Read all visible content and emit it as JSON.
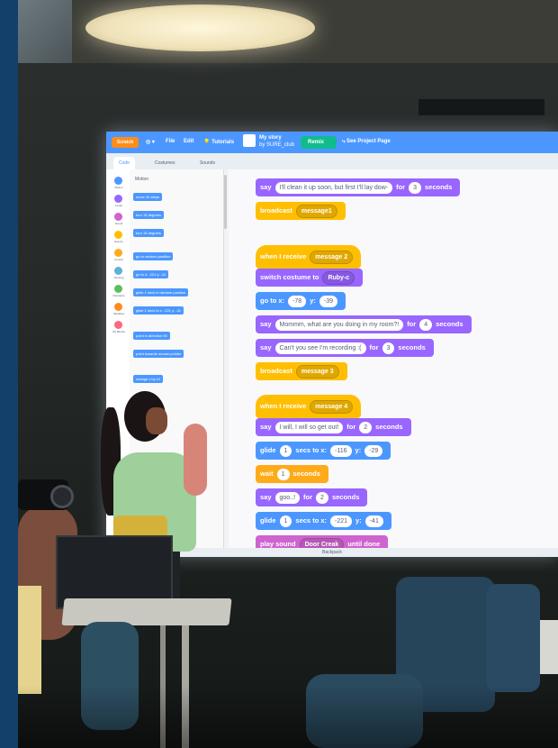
{
  "scratch": {
    "menu": [
      "File",
      "Edit",
      "Tutorials"
    ],
    "project_title": "My story",
    "author": "by SURE_club",
    "remix_label": "Remix",
    "see_project": "See Project Page",
    "tabs": [
      "Code",
      "Costumes",
      "Sounds"
    ],
    "categories": [
      "Motion",
      "Looks",
      "Sound",
      "Events",
      "Control",
      "Sensing",
      "Operators",
      "Variables",
      "My Blocks"
    ],
    "category_colors": [
      "#4c97ff",
      "#9966ff",
      "#cf63cf",
      "#ffbf00",
      "#ffab19",
      "#5cb1d6",
      "#59c059",
      "#ff8c1a",
      "#ff6680"
    ],
    "palette_title": "Motion",
    "palette_blocks": [
      "move 10 steps",
      "turn 15 degrees",
      "turn 15 degrees",
      "go to random position",
      "go to x: -221 y: -41",
      "glide 1 secs to random position",
      "glide 1 secs to x: -221 y: -41",
      "point in direction 90",
      "point towards mouse-pointer",
      "change x by 10"
    ],
    "backpack": "Backpack",
    "script_blocks": [
      {
        "kind": "looks",
        "words": [
          "say"
        ],
        "pill": "I'll clean it up soon, but first I'll lay dow-",
        "mid": "for",
        "pill2": "3",
        "end": "seconds"
      },
      {
        "kind": "event",
        "words": [
          "broadcast"
        ],
        "dd": "message1"
      },
      {
        "kind": "event hat",
        "words": [
          "when I receive"
        ],
        "dd": "message 2"
      },
      {
        "kind": "looks",
        "words": [
          "switch costume to"
        ],
        "dd": "Ruby-c"
      },
      {
        "kind": "motion",
        "words": [
          "go to x:"
        ],
        "pill": "-78",
        "mid": "y:",
        "pill2": "-39"
      },
      {
        "kind": "looks",
        "words": [
          "say"
        ],
        "pill": "Mommm, what are you doing in my room?!",
        "mid": "for",
        "pill2": "4",
        "end": "seconds"
      },
      {
        "kind": "looks",
        "words": [
          "say"
        ],
        "pill": "Can't you see I'm recording :(",
        "mid": "for",
        "pill2": "3",
        "end": "seconds"
      },
      {
        "kind": "event",
        "words": [
          "broadcast"
        ],
        "dd": "message 3"
      },
      {
        "kind": "event hat",
        "words": [
          "when I receive"
        ],
        "dd": "message 4"
      },
      {
        "kind": "looks",
        "words": [
          "say"
        ],
        "pill": "I will, I will so get out!",
        "mid": "for",
        "pill2": "2",
        "end": "seconds"
      },
      {
        "kind": "motion",
        "words": [
          "glide"
        ],
        "pill": "1",
        "mid": "secs to x:",
        "pill2": "-116",
        "mid2": "y:",
        "pill3": "-29"
      },
      {
        "kind": "control",
        "words": [
          "wait"
        ],
        "pill": "1",
        "end": "seconds"
      },
      {
        "kind": "looks",
        "words": [
          "say"
        ],
        "pill": "goo..!",
        "mid": "for",
        "pill2": "2",
        "end": "seconds"
      },
      {
        "kind": "motion",
        "words": [
          "glide"
        ],
        "pill": "1",
        "mid": "secs to x:",
        "pill2": "-221",
        "mid2": "y:",
        "pill3": "-41"
      },
      {
        "kind": "sound",
        "words": [
          "play sound"
        ],
        "dd": "Door Creak",
        "end": "until done"
      }
    ]
  }
}
